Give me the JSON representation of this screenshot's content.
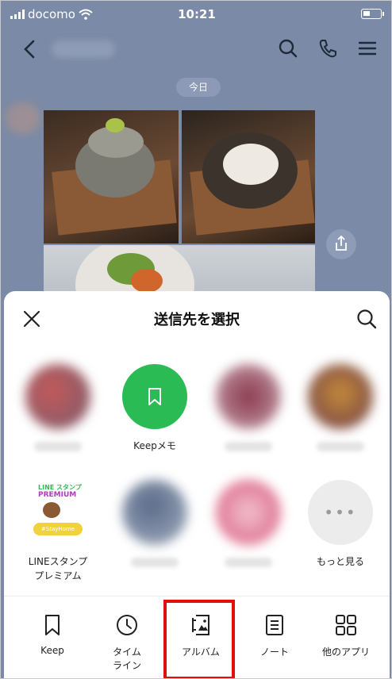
{
  "status_bar": {
    "carrier": "docomo",
    "time": "10:21"
  },
  "chat": {
    "date_label": "今日"
  },
  "sheet": {
    "title": "送信先を選択",
    "contacts_row1": [
      {
        "label": "",
        "blurred": true
      },
      {
        "label": "Keepメモ",
        "blurred": false
      },
      {
        "label": "",
        "blurred": true
      },
      {
        "label": "",
        "blurred": true
      }
    ],
    "contacts_row2": [
      {
        "label": "LINEスタンプ\nプレミアム",
        "badge_line1": "LINE スタンプ",
        "badge_line2": "PREMIUM",
        "badge_tag": "#StayHome"
      },
      {
        "label": "",
        "blurred": true
      },
      {
        "label": "",
        "blurred": true
      },
      {
        "label": "もっと見る",
        "icon": "more-icon"
      }
    ],
    "tabs": [
      {
        "label": "Keep",
        "icon": "bookmark-icon"
      },
      {
        "label": "タイム\nライン",
        "icon": "clock-icon"
      },
      {
        "label": "アルバム",
        "icon": "album-icon"
      },
      {
        "label": "ノート",
        "icon": "note-icon"
      },
      {
        "label": "他のアプリ",
        "icon": "grid-icon"
      }
    ]
  },
  "colors": {
    "accent_green": "#2bbb55",
    "highlight_red": "#e01010",
    "chat_bg": "#7b8aa6"
  }
}
